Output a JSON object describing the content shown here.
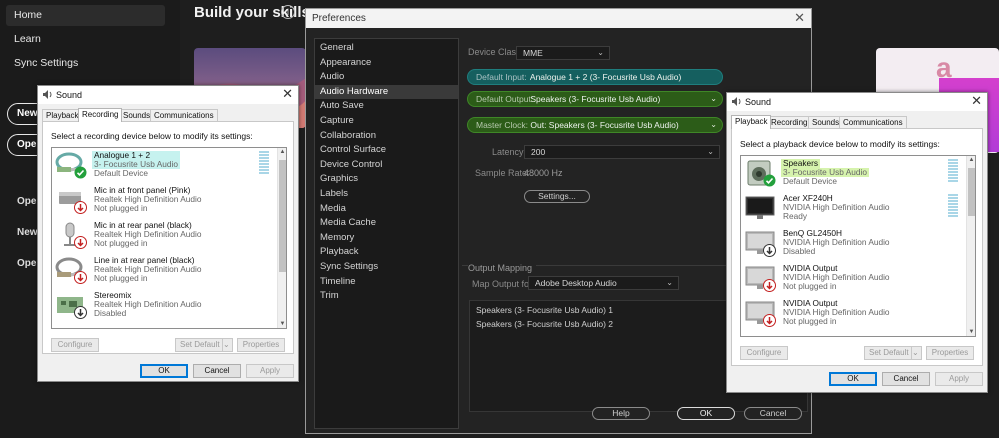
{
  "background": {
    "nav": [
      "Home",
      "Learn",
      "Sync Settings"
    ],
    "heading": "Build your skills",
    "pills": [
      "New",
      "Ope"
    ],
    "links": [
      "Ope",
      "New",
      "Ope"
    ]
  },
  "preferences": {
    "title": "Preferences",
    "categories": [
      "General",
      "Appearance",
      "Audio",
      "Audio Hardware",
      "Auto Save",
      "Capture",
      "Collaboration",
      "Control Surface",
      "Device Control",
      "Graphics",
      "Labels",
      "Media",
      "Media Cache",
      "Memory",
      "Playback",
      "Sync Settings",
      "Timeline",
      "Trim"
    ],
    "selected_category": "Audio Hardware",
    "device_class_label": "Device Class:",
    "device_class": "MME",
    "default_input_label": "Default Input:",
    "default_input": "Analogue 1 + 2 (3- Focusrite Usb Audio)",
    "default_output_label": "Default Output:",
    "default_output": "Speakers (3- Focusrite Usb Audio)",
    "master_clock_label": "Master Clock:",
    "master_clock": "Out: Speakers (3- Focusrite Usb Audio)",
    "latency_label": "Latency:",
    "latency": "200",
    "sample_rate_label": "Sample Rate:",
    "sample_rate": "48000 Hz",
    "settings_button": "Settings...",
    "output_mapping_title": "Output Mapping",
    "map_output_label": "Map Output for:",
    "map_output": "Adobe Desktop Audio",
    "map_rows": [
      "Speakers (3- Focusrite Usb Audio) 1",
      "Speakers (3- Focusrite Usb Audio) 2"
    ],
    "buttons": {
      "help": "Help",
      "ok": "OK",
      "cancel": "Cancel"
    }
  },
  "sound_recording": {
    "title": "Sound",
    "tabs": [
      "Playback",
      "Recording",
      "Sounds",
      "Communications"
    ],
    "selected_tab": "Recording",
    "instruction": "Select a recording device below to modify its settings:",
    "devices": [
      {
        "name": "Analogue 1 + 2",
        "line2": "3- Focusrite Usb Audio",
        "line3": "Default Device",
        "icon": "line-in-cable-icon",
        "status": "default-check"
      },
      {
        "name": "Mic in at front panel (Pink)",
        "line2": "Realtek High Definition Audio",
        "line3": "Not plugged in",
        "icon": "microphone-icon",
        "status": "unplugged-arrow"
      },
      {
        "name": "Mic in at rear panel (black)",
        "line2": "Realtek High Definition Audio",
        "line3": "Not plugged in",
        "icon": "microphone-icon",
        "status": "unplugged-arrow"
      },
      {
        "name": "Line in at rear panel (black)",
        "line2": "Realtek High Definition Audio",
        "line3": "Not plugged in",
        "icon": "line-in-cable-icon",
        "status": "unplugged-arrow"
      },
      {
        "name": "Stereomix",
        "line2": "Realtek High Definition Audio",
        "line3": "Disabled",
        "icon": "circuit-board-icon",
        "status": "disabled-arrow"
      }
    ],
    "buttons": {
      "configure": "Configure",
      "set_default": "Set Default",
      "properties": "Properties",
      "ok": "OK",
      "cancel": "Cancel",
      "apply": "Apply"
    }
  },
  "sound_playback": {
    "title": "Sound",
    "tabs": [
      "Playback",
      "Recording",
      "Sounds",
      "Communications"
    ],
    "selected_tab": "Playback",
    "instruction": "Select a playback device below to modify its settings:",
    "devices": [
      {
        "name": "Speakers",
        "line2": "3- Focusrite Usb Audio",
        "line3": "Default Device",
        "icon": "speaker-icon",
        "status": "default-check"
      },
      {
        "name": "Acer XF240H",
        "line2": "NVIDIA High Definition Audio",
        "line3": "Ready",
        "icon": "monitor-icon",
        "status": "none"
      },
      {
        "name": "BenQ GL2450H",
        "line2": "NVIDIA High Definition Audio",
        "line3": "Disabled",
        "icon": "monitor-icon",
        "status": "disabled-arrow"
      },
      {
        "name": "NVIDIA Output",
        "line2": "NVIDIA High Definition Audio",
        "line3": "Not plugged in",
        "icon": "monitor-icon",
        "status": "unplugged-arrow"
      },
      {
        "name": "NVIDIA Output",
        "line2": "NVIDIA High Definition Audio",
        "line3": "Not plugged in",
        "icon": "monitor-icon",
        "status": "unplugged-arrow"
      }
    ],
    "buttons": {
      "configure": "Configure",
      "set_default": "Set Default",
      "properties": "Properties",
      "ok": "OK",
      "cancel": "Cancel",
      "apply": "Apply"
    }
  },
  "colors": {
    "teal_pill": "#155f5f",
    "green_pill": "#2c5c18",
    "highlight_cyan": "#c6f2ef",
    "highlight_green": "#d6f3ad",
    "windows_blue": "#0078d7"
  }
}
